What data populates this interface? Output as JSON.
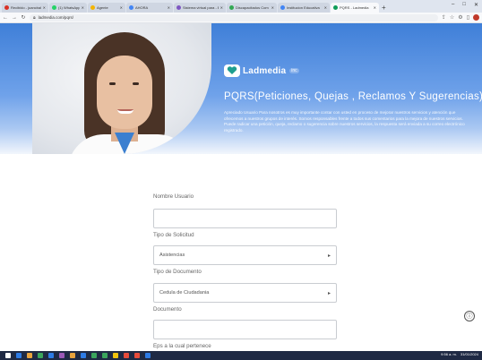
{
  "browser": {
    "tabs": [
      {
        "title": "Recibido - juancbaltazar",
        "color": "#d93025",
        "active": false
      },
      {
        "title": "(1) WhatsApp",
        "color": "#25d366",
        "active": false
      },
      {
        "title": "Agente",
        "color": "#f4b400",
        "active": false
      },
      {
        "title": "AHORA",
        "color": "#4285f4",
        "active": false
      },
      {
        "title": "Sistema virtual para - Bus",
        "color": "#7e57c2",
        "active": false
      },
      {
        "title": "Discapacitados Com",
        "color": "#34a853",
        "active": false
      },
      {
        "title": "Institucion Educativa",
        "color": "#4285f4",
        "active": false
      },
      {
        "title": "PQRS - Ladmedia",
        "color": "#0f9d58",
        "active": true
      }
    ],
    "new_tab": "+",
    "url": "ladmedia.com/pqrs/",
    "controls": {
      "minimize": "–",
      "maximize": "□",
      "close": "✕"
    }
  },
  "banner": {
    "logo_text": "Ladmedia",
    "logo_suffix": "inc",
    "title": "PQRS(Peticiones, Quejas , Reclamos Y Sugerencias)",
    "description": "Apreciado Usuario Para nosotros es muy importante contar con usted en proceso de mejorar nuestros servicios y atención que ofrecemos a nuestros grupos de interés. Somos responsables frente a todos sus comentarios para la mejora de nuestros servicios. Puede radicar una petición, queja, reclamo o sugerencia sobre nuestros servicios, la respuesta será enviada a su correo electrónico registrado."
  },
  "form": {
    "fields": [
      {
        "label": "Nombre Usuario",
        "value": "",
        "type": "text"
      },
      {
        "label": "Tipo de Solicitud",
        "value": "Asistencias",
        "type": "select"
      },
      {
        "label": "Tipo de Documento",
        "value": "Cedula de Ciudadania",
        "type": "select"
      },
      {
        "label": "Documento",
        "value": "",
        "type": "text"
      },
      {
        "label": "Eps a la cual pertenece",
        "value": "",
        "type": "text"
      }
    ],
    "select_caret": "▸"
  },
  "help_icon": "ⓘ",
  "taskbar": {
    "time": "9:56 a. m.",
    "date": "31/01/2024",
    "apps": [
      "#ffffff",
      "#2d7be5",
      "#e8a33d",
      "#3ba55d",
      "#2d7be5",
      "#9b59b6",
      "#e8a33d",
      "#2d7be5",
      "#3ba55d",
      "#3ba55d",
      "#f1c40f",
      "#e74c3c",
      "#e74c3c",
      "#2d7be5"
    ]
  }
}
